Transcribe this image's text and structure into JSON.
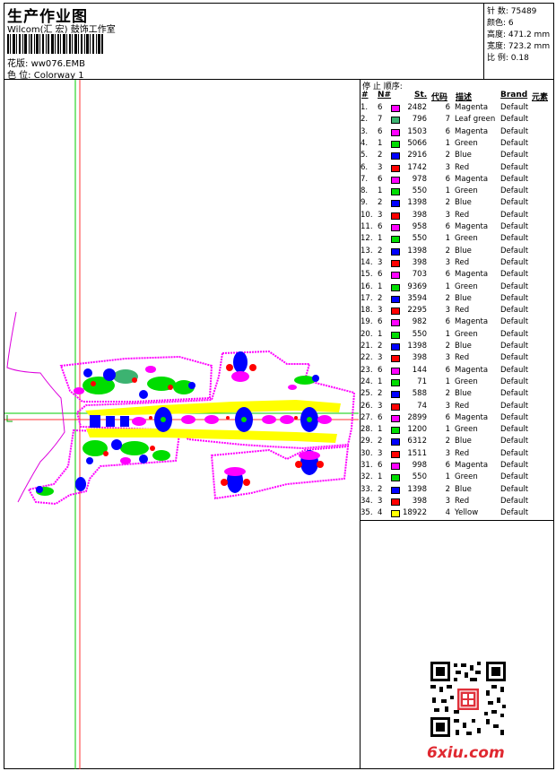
{
  "header": {
    "title": "生产作业图",
    "subtitle": "Wilcom(汇 宏) 鼓饰工作室",
    "pattern_label": "花版:",
    "pattern_value": "ww076.EMB",
    "colorway_label": "色 位:",
    "colorway_value": "Colorway 1"
  },
  "stats": [
    {
      "label": "针 数:",
      "value": "75489"
    },
    {
      "label": "颜色:",
      "value": "6"
    },
    {
      "label": "高度:",
      "value": "471.2 mm"
    },
    {
      "label": "宽度:",
      "value": "723.2 mm"
    },
    {
      "label": "比 例:",
      "value": "0.18"
    }
  ],
  "stop_sequence": {
    "title": "停 止 顺序:",
    "columns": [
      "#",
      "N#",
      "St.",
      "代码",
      "描述",
      "Brand",
      "元素"
    ],
    "rows": [
      {
        "i": "1.",
        "n": "6",
        "st": "2482",
        "code": "6",
        "desc": "Magenta",
        "brand": "Default",
        "color": "#ff00ff"
      },
      {
        "i": "2.",
        "n": "7",
        "st": "796",
        "code": "7",
        "desc": "Leaf green",
        "brand": "Default",
        "color": "#3cb371"
      },
      {
        "i": "3.",
        "n": "6",
        "st": "1503",
        "code": "6",
        "desc": "Magenta",
        "brand": "Default",
        "color": "#ff00ff"
      },
      {
        "i": "4.",
        "n": "1",
        "st": "5066",
        "code": "1",
        "desc": "Green",
        "brand": "Default",
        "color": "#00dd00"
      },
      {
        "i": "5.",
        "n": "2",
        "st": "2916",
        "code": "2",
        "desc": "Blue",
        "brand": "Default",
        "color": "#0000ff"
      },
      {
        "i": "6.",
        "n": "3",
        "st": "1742",
        "code": "3",
        "desc": "Red",
        "brand": "Default",
        "color": "#ff0000"
      },
      {
        "i": "7.",
        "n": "6",
        "st": "978",
        "code": "6",
        "desc": "Magenta",
        "brand": "Default",
        "color": "#ff00ff"
      },
      {
        "i": "8.",
        "n": "1",
        "st": "550",
        "code": "1",
        "desc": "Green",
        "brand": "Default",
        "color": "#00dd00"
      },
      {
        "i": "9.",
        "n": "2",
        "st": "1398",
        "code": "2",
        "desc": "Blue",
        "brand": "Default",
        "color": "#0000ff"
      },
      {
        "i": "10.",
        "n": "3",
        "st": "398",
        "code": "3",
        "desc": "Red",
        "brand": "Default",
        "color": "#ff0000"
      },
      {
        "i": "11.",
        "n": "6",
        "st": "958",
        "code": "6",
        "desc": "Magenta",
        "brand": "Default",
        "color": "#ff00ff"
      },
      {
        "i": "12.",
        "n": "1",
        "st": "550",
        "code": "1",
        "desc": "Green",
        "brand": "Default",
        "color": "#00dd00"
      },
      {
        "i": "13.",
        "n": "2",
        "st": "1398",
        "code": "2",
        "desc": "Blue",
        "brand": "Default",
        "color": "#0000ff"
      },
      {
        "i": "14.",
        "n": "3",
        "st": "398",
        "code": "3",
        "desc": "Red",
        "brand": "Default",
        "color": "#ff0000"
      },
      {
        "i": "15.",
        "n": "6",
        "st": "703",
        "code": "6",
        "desc": "Magenta",
        "brand": "Default",
        "color": "#ff00ff"
      },
      {
        "i": "16.",
        "n": "1",
        "st": "9369",
        "code": "1",
        "desc": "Green",
        "brand": "Default",
        "color": "#00dd00"
      },
      {
        "i": "17.",
        "n": "2",
        "st": "3594",
        "code": "2",
        "desc": "Blue",
        "brand": "Default",
        "color": "#0000ff"
      },
      {
        "i": "18.",
        "n": "3",
        "st": "2295",
        "code": "3",
        "desc": "Red",
        "brand": "Default",
        "color": "#ff0000"
      },
      {
        "i": "19.",
        "n": "6",
        "st": "982",
        "code": "6",
        "desc": "Magenta",
        "brand": "Default",
        "color": "#ff00ff"
      },
      {
        "i": "20.",
        "n": "1",
        "st": "550",
        "code": "1",
        "desc": "Green",
        "brand": "Default",
        "color": "#00dd00"
      },
      {
        "i": "21.",
        "n": "2",
        "st": "1398",
        "code": "2",
        "desc": "Blue",
        "brand": "Default",
        "color": "#0000ff"
      },
      {
        "i": "22.",
        "n": "3",
        "st": "398",
        "code": "3",
        "desc": "Red",
        "brand": "Default",
        "color": "#ff0000"
      },
      {
        "i": "23.",
        "n": "6",
        "st": "144",
        "code": "6",
        "desc": "Magenta",
        "brand": "Default",
        "color": "#ff00ff"
      },
      {
        "i": "24.",
        "n": "1",
        "st": "71",
        "code": "1",
        "desc": "Green",
        "brand": "Default",
        "color": "#00dd00"
      },
      {
        "i": "25.",
        "n": "2",
        "st": "588",
        "code": "2",
        "desc": "Blue",
        "brand": "Default",
        "color": "#0000ff"
      },
      {
        "i": "26.",
        "n": "3",
        "st": "74",
        "code": "3",
        "desc": "Red",
        "brand": "Default",
        "color": "#ff0000"
      },
      {
        "i": "27.",
        "n": "6",
        "st": "2899",
        "code": "6",
        "desc": "Magenta",
        "brand": "Default",
        "color": "#ff00ff"
      },
      {
        "i": "28.",
        "n": "1",
        "st": "1200",
        "code": "1",
        "desc": "Green",
        "brand": "Default",
        "color": "#00dd00"
      },
      {
        "i": "29.",
        "n": "2",
        "st": "6312",
        "code": "2",
        "desc": "Blue",
        "brand": "Default",
        "color": "#0000ff"
      },
      {
        "i": "30.",
        "n": "3",
        "st": "1511",
        "code": "3",
        "desc": "Red",
        "brand": "Default",
        "color": "#ff0000"
      },
      {
        "i": "31.",
        "n": "6",
        "st": "998",
        "code": "6",
        "desc": "Magenta",
        "brand": "Default",
        "color": "#ff00ff"
      },
      {
        "i": "32.",
        "n": "1",
        "st": "550",
        "code": "1",
        "desc": "Green",
        "brand": "Default",
        "color": "#00dd00"
      },
      {
        "i": "33.",
        "n": "2",
        "st": "1398",
        "code": "2",
        "desc": "Blue",
        "brand": "Default",
        "color": "#0000ff"
      },
      {
        "i": "34.",
        "n": "3",
        "st": "398",
        "code": "3",
        "desc": "Red",
        "brand": "Default",
        "color": "#ff0000"
      },
      {
        "i": "35.",
        "n": "4",
        "st": "18922",
        "code": "4",
        "desc": "Yellow",
        "brand": "Default",
        "color": "#ffff00"
      }
    ]
  },
  "watermark": {
    "site": "6xiu.com"
  },
  "icons": {
    "qr": "qr-code-icon",
    "seal": "seal-stamp-icon",
    "origin": "origin-marker-icon"
  }
}
